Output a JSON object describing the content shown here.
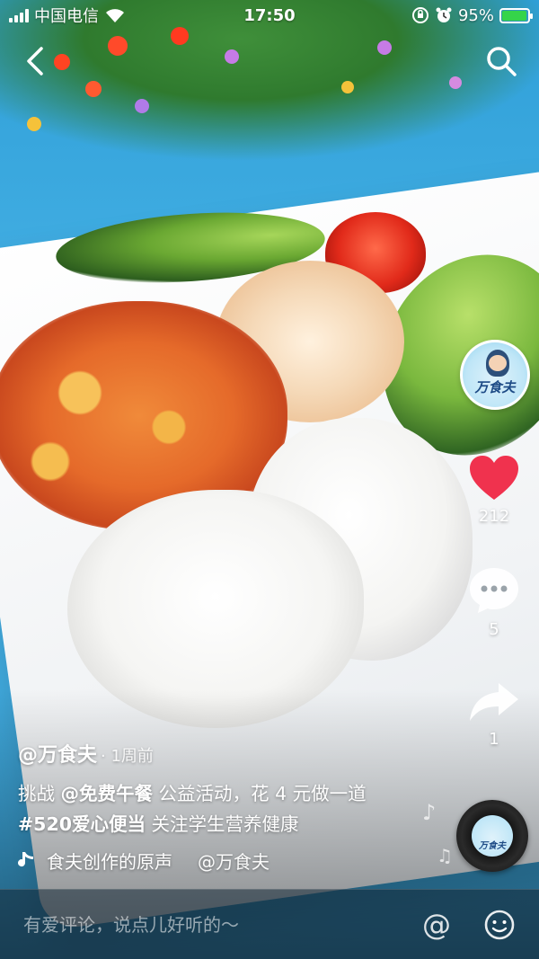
{
  "status_bar": {
    "carrier": "中国电信",
    "time": "17:50",
    "battery": "95%",
    "battery_level": 0.95
  },
  "video": {
    "avatar_text": "万食夫",
    "likes": "212",
    "comments": "5",
    "shares": "1",
    "author": "@万食夫",
    "posted": "· 1周前",
    "desc_prefix": "挑战 ",
    "desc_mention": "@免费午餐",
    "desc_middle": " 公益活动，花 4 元做一道",
    "desc_hashtag": "#520爱心便当",
    "desc_suffix": " 关注学生营养健康",
    "music_title": "食夫创作的原声",
    "music_author": "@万食夫",
    "disc_text": "万食夫"
  },
  "comment_bar": {
    "placeholder": "有爱评论，说点儿好听的～",
    "at_label": "@"
  },
  "colors": {
    "like": "#f0324e",
    "battery": "#35d44a",
    "accent_blue": "#1d4b86"
  },
  "icons": [
    "back-icon",
    "search-icon",
    "heart-icon",
    "comment-icon",
    "share-icon",
    "music-note-icon",
    "emoji-icon",
    "wifi-icon",
    "alarm-icon",
    "lock-rotation-icon"
  ]
}
